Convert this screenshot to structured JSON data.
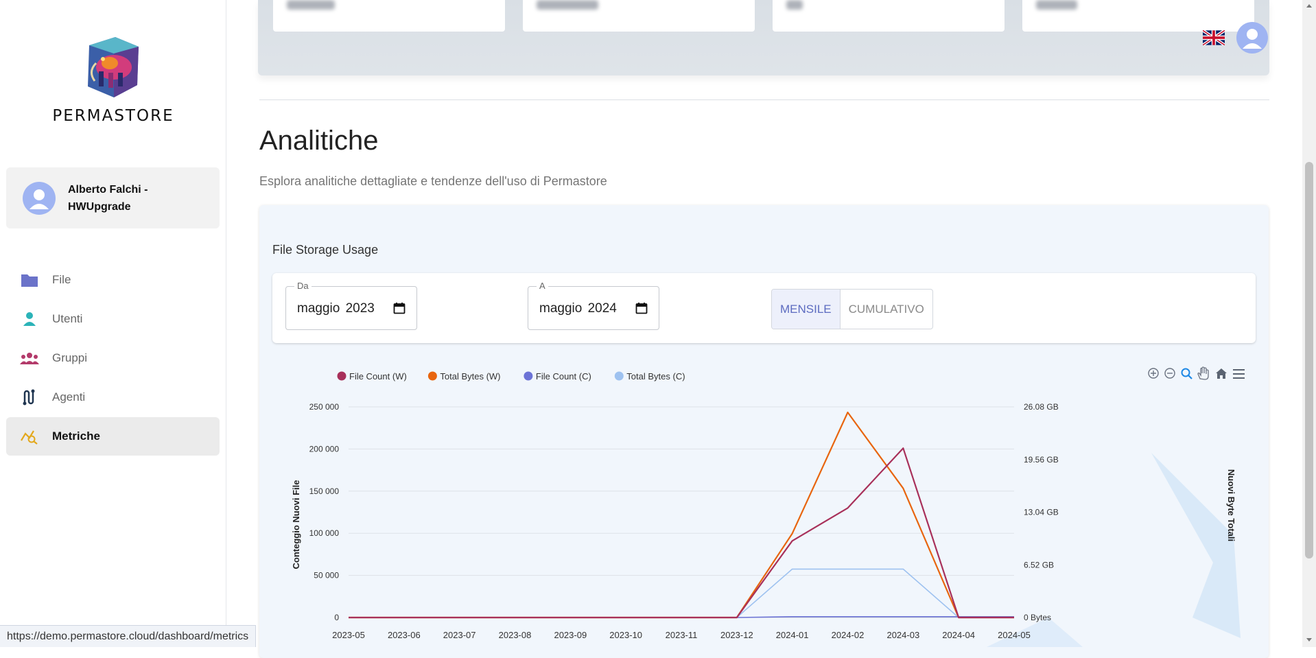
{
  "sidebar": {
    "brand": "PERMASTORE",
    "user": {
      "name": "Alberto Falchi - HWUpgrade"
    },
    "items": [
      {
        "label": "File",
        "icon": "folder-icon",
        "active": false
      },
      {
        "label": "Utenti",
        "icon": "user-icon",
        "active": false
      },
      {
        "label": "Gruppi",
        "icon": "groups-icon",
        "active": false
      },
      {
        "label": "Agenti",
        "icon": "agents-icon",
        "active": false
      },
      {
        "label": "Metriche",
        "icon": "metrics-icon",
        "active": true
      }
    ]
  },
  "status_url": "https://demo.permastore.cloud/dashboard/metrics",
  "header": {
    "language": "en-GB flag",
    "account_icon": "account-avatar-icon"
  },
  "page": {
    "title": "Analitiche",
    "subtitle": "Esplora analitiche dettagliate e tendenze dell'uso di Permastore"
  },
  "card": {
    "title": "File Storage Usage",
    "from": {
      "label": "Da",
      "value": "maggio 2023"
    },
    "to": {
      "label": "A",
      "value": "maggio 2024"
    },
    "toggle": {
      "monthly": "MENSILE",
      "cumulative": "CUMULATIVO",
      "selected": "MENSILE"
    }
  },
  "chart_toolbar": [
    "zoom-in-icon",
    "zoom-out-icon",
    "selection-zoom-icon",
    "pan-icon",
    "reset-home-icon",
    "menu-icon"
  ],
  "colors": {
    "file_count_w": "#a8305a",
    "total_bytes_w": "#e8650f",
    "file_count_c": "#6c73d6",
    "total_bytes_c": "#9ec2f0",
    "accent": "#5c6bc0"
  },
  "chart_data": {
    "type": "line",
    "categories": [
      "2023-05",
      "2023-06",
      "2023-07",
      "2023-08",
      "2023-09",
      "2023-10",
      "2023-11",
      "2023-12",
      "2024-01",
      "2024-02",
      "2024-03",
      "2024-04",
      "2024-05"
    ],
    "ylabel": "Conteggio Nuovi File",
    "y2label": "Nuovi Byte Totali",
    "ylim": [
      0,
      250000
    ],
    "y_ticks": [
      "0",
      "50 000",
      "100 000",
      "150 000",
      "200 000",
      "250 000"
    ],
    "y2_ticks": [
      "0 Bytes",
      "6.52 GB",
      "13.04 GB",
      "19.56 GB",
      "26.08 GB"
    ],
    "y2lim_gb": [
      0,
      26.08
    ],
    "legend_position": "top-left",
    "grid": true,
    "series": [
      {
        "name": "File Count (W)",
        "axis": "left",
        "color": "#a8305a",
        "values": [
          0,
          0,
          0,
          0,
          0,
          0,
          0,
          0,
          91000,
          130000,
          201000,
          0,
          0
        ]
      },
      {
        "name": "Total Bytes (W)",
        "axis": "right",
        "unit": "GB",
        "color": "#e8650f",
        "values": [
          0,
          0,
          0,
          0,
          0,
          0,
          0,
          0,
          10.4,
          25.4,
          16.0,
          0,
          0
        ]
      },
      {
        "name": "File Count (C)",
        "axis": "left",
        "color": "#6c73d6",
        "values": [
          0,
          0,
          0,
          0,
          0,
          0,
          0,
          0,
          1000,
          1000,
          1000,
          1000,
          1000
        ]
      },
      {
        "name": "Total Bytes (C)",
        "axis": "right",
        "unit": "GB",
        "color": "#9ec2f0",
        "values": [
          0,
          0,
          0,
          0,
          0,
          0,
          0,
          0,
          6.0,
          6.0,
          6.0,
          0,
          0
        ]
      }
    ]
  }
}
